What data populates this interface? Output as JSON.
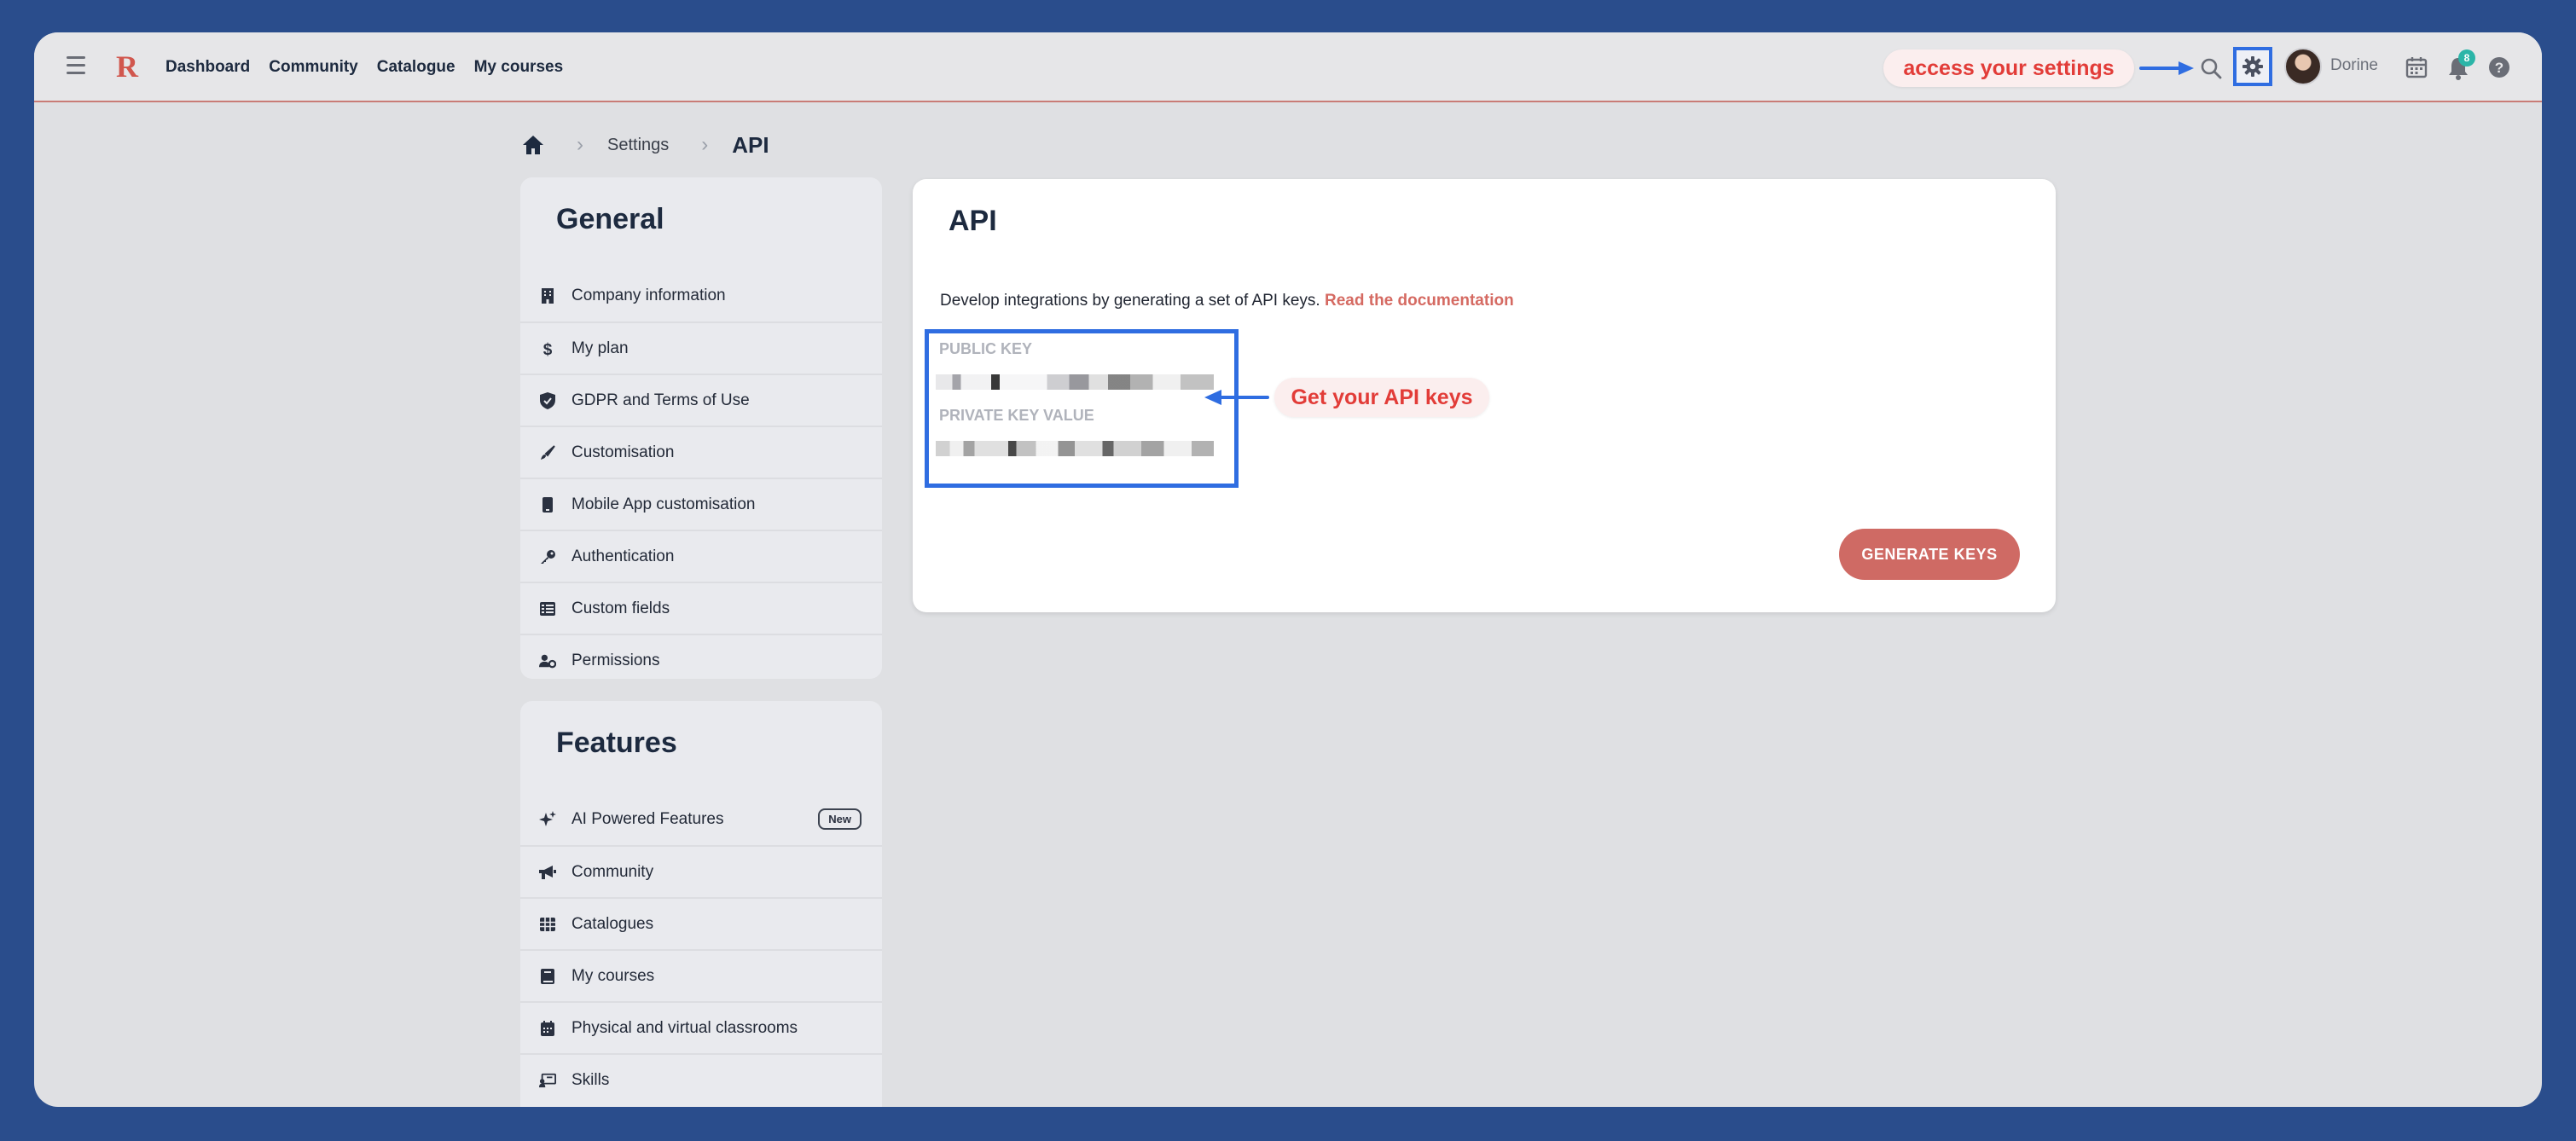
{
  "topbar": {
    "logo": "R",
    "nav": [
      "Dashboard",
      "Community",
      "Catalogue",
      "My courses"
    ],
    "settings_callout": "access your settings",
    "username": "Dorine",
    "notification_count": "8"
  },
  "breadcrumb": {
    "settings": "Settings",
    "current": "API"
  },
  "general": {
    "title": "General",
    "items": [
      {
        "label": "Company information",
        "icon": "building-icon"
      },
      {
        "label": "My plan",
        "icon": "dollar-icon"
      },
      {
        "label": "GDPR and Terms of Use",
        "icon": "shield-icon"
      },
      {
        "label": "Customisation",
        "icon": "brush-icon"
      },
      {
        "label": "Mobile App customisation",
        "icon": "mobile-icon"
      },
      {
        "label": "Authentication",
        "icon": "key-icon"
      },
      {
        "label": "Custom fields",
        "icon": "list-icon"
      },
      {
        "label": "Permissions",
        "icon": "user-gear-icon"
      }
    ]
  },
  "features": {
    "title": "Features",
    "items": [
      {
        "label": "AI Powered Features",
        "icon": "sparkles-icon",
        "badge": "New"
      },
      {
        "label": "Community",
        "icon": "megaphone-icon"
      },
      {
        "label": "Catalogues",
        "icon": "grid-icon"
      },
      {
        "label": "My courses",
        "icon": "book-icon"
      },
      {
        "label": "Physical and virtual classrooms",
        "icon": "calendar-icon"
      },
      {
        "label": "Skills",
        "icon": "skills-icon"
      }
    ]
  },
  "api": {
    "title": "API",
    "intro": "Develop integrations by generating a set of API keys. ",
    "doc_link": "Read the documentation",
    "public_key_label": "PUBLIC KEY",
    "private_key_label": "PRIVATE KEY VALUE",
    "keys_callout": "Get your API keys",
    "generate_button": "GENERATE KEYS"
  },
  "colors": {
    "accent": "#2f6de1",
    "brand": "#cf6a64",
    "callout_text": "#e23c38",
    "background": "#2a4d8c"
  }
}
